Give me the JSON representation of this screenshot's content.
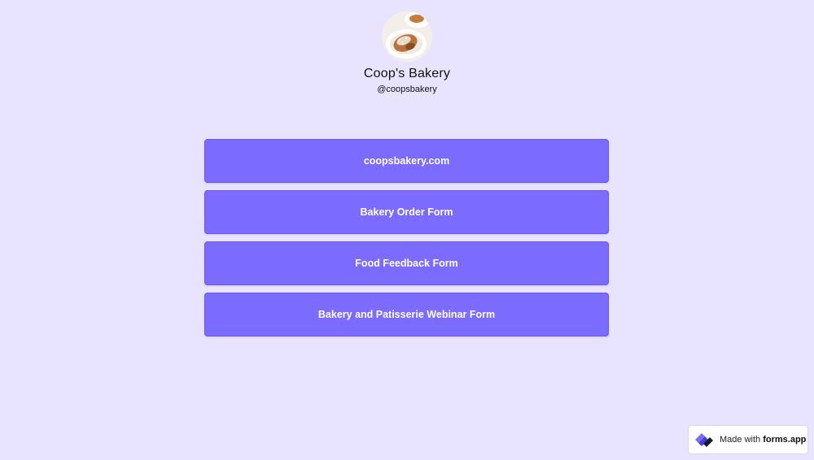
{
  "profile": {
    "name": "Coop's Bakery",
    "handle": "@coopsbakery",
    "avatar_icon": "croissant-photo"
  },
  "links": [
    {
      "label": "coopsbakery.com"
    },
    {
      "label": "Bakery Order Form"
    },
    {
      "label": "Food Feedback Form"
    },
    {
      "label": "Bakery and Patisserie Webinar Form"
    }
  ],
  "badge": {
    "prefix": "Made with ",
    "brand": "forms.app",
    "icon": "forms-app-logo-icon"
  },
  "colors": {
    "background": "#e8e3fe",
    "button": "#7b6bff",
    "button_text": "#ffffff"
  }
}
